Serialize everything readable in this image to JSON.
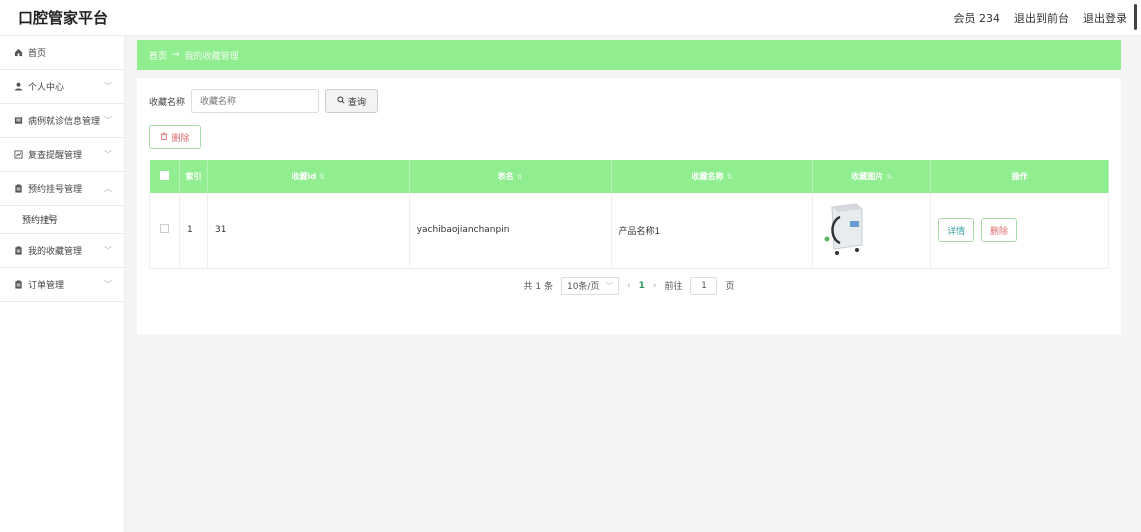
{
  "header": {
    "title": "口腔管家平台",
    "member": "会员 234",
    "go_front": "退出到前台",
    "logout": "退出登录"
  },
  "sidebar": {
    "items": [
      {
        "label": "首页",
        "icon": "home-icon"
      },
      {
        "label": "个人中心",
        "icon": "user-icon"
      },
      {
        "label": "病例就诊信息管理",
        "icon": "document-icon"
      },
      {
        "label": "复查提醒管理",
        "icon": "chart-icon"
      },
      {
        "label": "预约挂号管理",
        "icon": "clipboard-icon"
      },
      {
        "label": "我的收藏管理",
        "icon": "clipboard-icon"
      },
      {
        "label": "订单管理",
        "icon": "clipboard-icon"
      }
    ],
    "sub_item": "预约挂号"
  },
  "breadcrumb": {
    "home": "首页",
    "arrow": "→",
    "current": "我的收藏管理"
  },
  "search": {
    "label": "收藏名称",
    "placeholder": "收藏名称",
    "button": "查询"
  },
  "actions": {
    "delete": "删除"
  },
  "table": {
    "columns": [
      "索引",
      "收藏id",
      "表名",
      "收藏名称",
      "收藏图片",
      "操作"
    ],
    "rows": [
      {
        "index": "1",
        "id": "31",
        "table_name": "yachibaojianchanpin",
        "name": "产品名称1",
        "detail": "详情",
        "delete": "删除"
      }
    ]
  },
  "pager": {
    "total": "共 1 条",
    "per_page": "10条/页",
    "page": "1",
    "goto_prefix": "前往",
    "goto_value": "1",
    "goto_suffix": "页"
  },
  "colors": {
    "accent": "#90ee90",
    "danger": "#e06b6b",
    "link": "#3aa0a0"
  }
}
